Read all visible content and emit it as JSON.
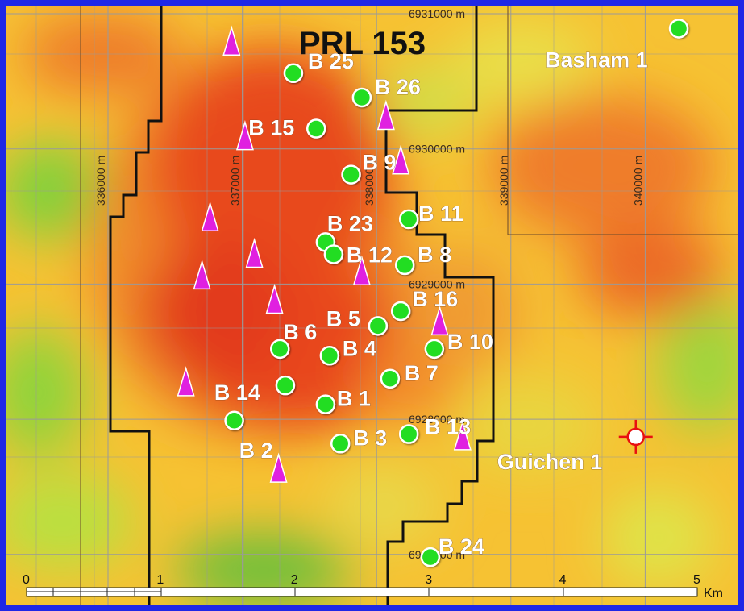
{
  "title": "PRL 153",
  "colors": {
    "frame": "#1f28e6",
    "well_green": "#22dd22",
    "triangle_magenta": "#e020e0",
    "boundary": "#111111",
    "grid": "#9a9a9a"
  },
  "grid_labels": {
    "eastings": [
      "336000 m",
      "337000 m",
      "338000 m",
      "339000 m",
      "340000 m"
    ],
    "northings": [
      "6931000 m",
      "6930000 m",
      "6929000 m",
      "6928000 m",
      "6927000 m"
    ]
  },
  "wells": [
    {
      "name": "B 25",
      "easting": 337380,
      "northing": 6930560
    },
    {
      "name": "B 26",
      "easting": 337890,
      "northing": 6930380
    },
    {
      "name": "B 15",
      "easting": 337550,
      "northing": 6930150
    },
    {
      "name": "B 9",
      "easting": 337810,
      "northing": 6929810
    },
    {
      "name": "B 11",
      "easting": 338240,
      "northing": 6929480
    },
    {
      "name": "B 23",
      "easting": 337620,
      "northing": 6929310
    },
    {
      "name": "B 12",
      "easting": 337680,
      "northing": 6929220
    },
    {
      "name": "B 8",
      "easting": 338210,
      "northing": 6929140
    },
    {
      "name": "B 16",
      "easting": 338180,
      "northing": 6928800
    },
    {
      "name": "B 5",
      "easting": 338010,
      "northing": 6928690
    },
    {
      "name": "B 10",
      "easting": 338430,
      "northing": 6928520
    },
    {
      "name": "B 6",
      "easting": 337280,
      "northing": 6928520
    },
    {
      "name": "B 4",
      "easting": 337650,
      "northing": 6928470
    },
    {
      "name": "B 7",
      "easting": 338100,
      "northing": 6928300
    },
    {
      "name": "B 14",
      "easting": 337320,
      "northing": 6928250
    },
    {
      "name": "B 1",
      "easting": 337620,
      "northing": 6928110
    },
    {
      "name": "B 2",
      "easting": 336940,
      "northing": 6927990
    },
    {
      "name": "B 3",
      "easting": 337730,
      "northing": 6927820
    },
    {
      "name": "B 13",
      "easting": 338240,
      "northing": 6927890
    },
    {
      "name": "B 24",
      "easting": 338400,
      "northing": 6926980
    },
    {
      "name": "Basham 1",
      "easting": 340250,
      "northing": 6930890
    }
  ],
  "triangles": [
    {
      "easting": 336920,
      "northing": 6930790
    },
    {
      "easting": 337020,
      "northing": 6930090
    },
    {
      "easting": 338070,
      "northing": 6930240
    },
    {
      "easting": 338180,
      "northing": 6929910
    },
    {
      "easting": 336760,
      "northing": 6929490
    },
    {
      "easting": 337090,
      "northing": 6929220
    },
    {
      "easting": 336700,
      "northing": 6929060
    },
    {
      "easting": 337890,
      "northing": 6929090
    },
    {
      "easting": 337240,
      "northing": 6928880
    },
    {
      "easting": 338470,
      "northing": 6928720
    },
    {
      "easting": 336580,
      "northing": 6928270
    },
    {
      "easting": 338640,
      "northing": 6927870
    },
    {
      "easting": 337270,
      "northing": 6927630
    }
  ],
  "guichen": {
    "name": "Guichen 1",
    "easting": 339930,
    "northing": 6927870
  },
  "scale_bar": {
    "ticks": [
      "0",
      "1",
      "2",
      "3",
      "4",
      "5"
    ],
    "unit": "Km"
  }
}
